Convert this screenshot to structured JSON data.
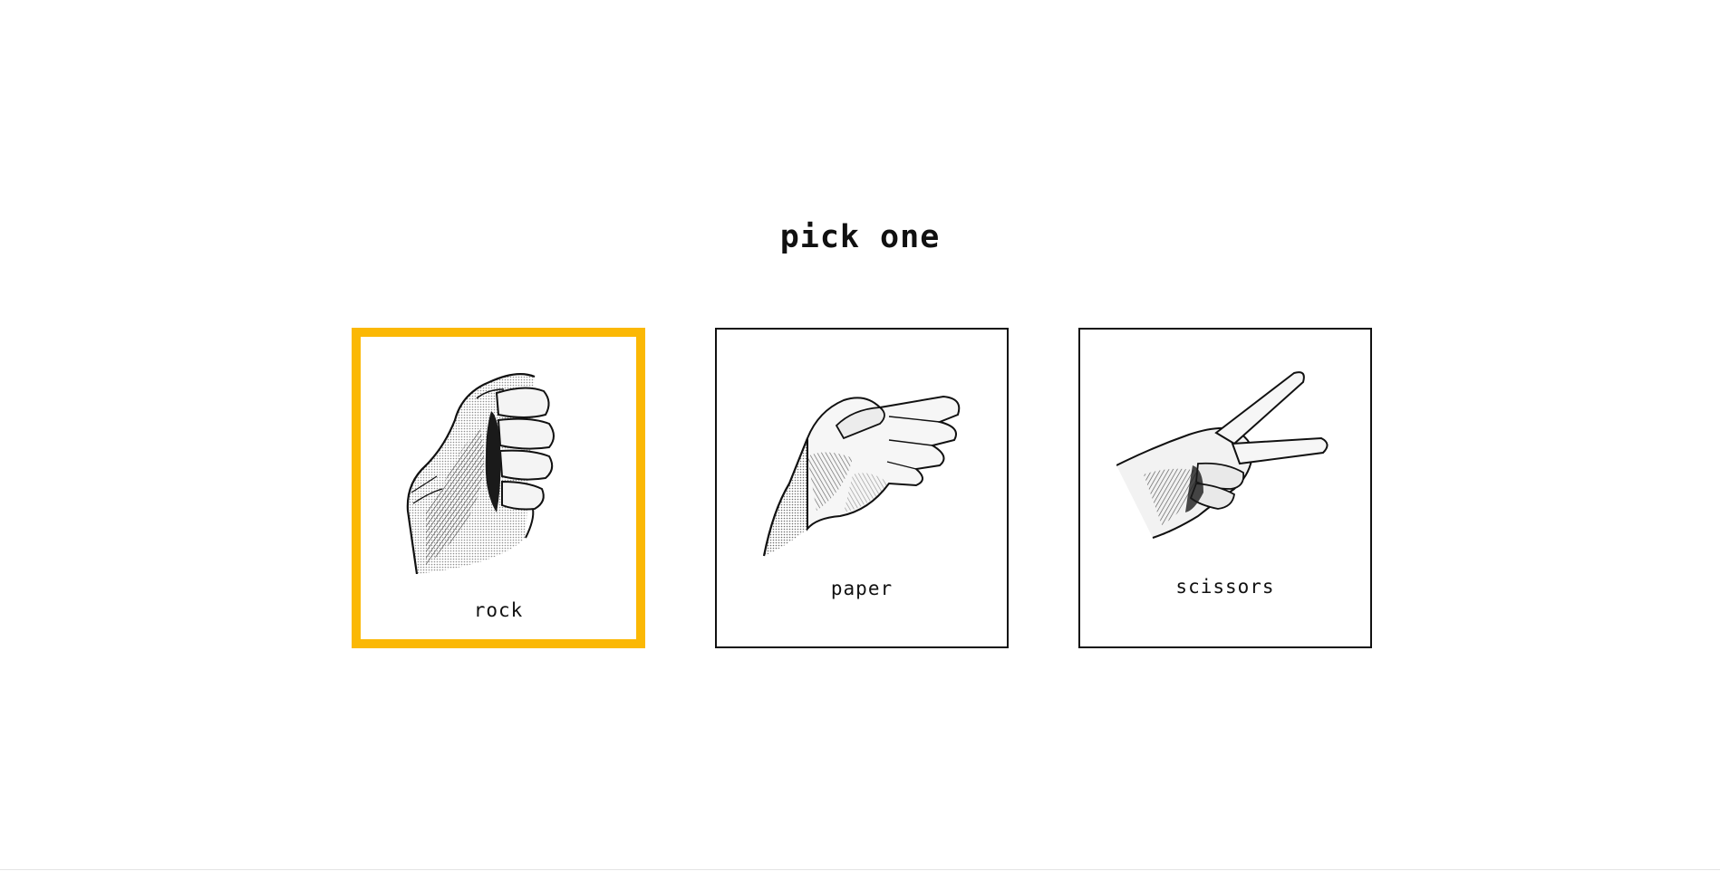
{
  "game": {
    "title": "pick one",
    "selected": "rock",
    "highlight_color": "#fbb805",
    "options": [
      {
        "id": "rock",
        "label": "rock",
        "icon": "rock-fist-hand-icon"
      },
      {
        "id": "paper",
        "label": "paper",
        "icon": "paper-flat-hand-icon"
      },
      {
        "id": "scissors",
        "label": "scissors",
        "icon": "scissors-two-finger-hand-icon"
      }
    ]
  }
}
